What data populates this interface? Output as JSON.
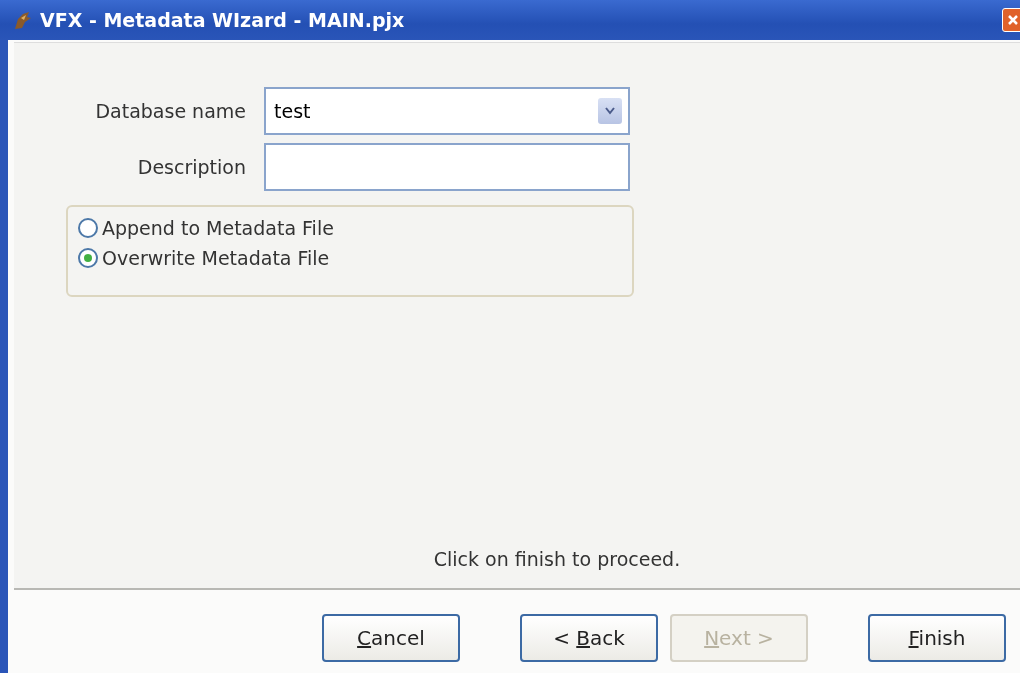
{
  "window": {
    "title": "VFX - Metadata WIzard - MAIN.pjx"
  },
  "fields": [
    {
      "kind": "dropdown",
      "label": "Database name",
      "value": "test"
    },
    {
      "kind": "text",
      "label": "Description"
    }
  ],
  "options": [
    {
      "label": "Append to Metadata File",
      "selected": false
    },
    {
      "label": "Overwrite Metadata File",
      "selected": true
    }
  ],
  "message": "Click on finish to proceed.",
  "buttons": [
    {
      "key": "C",
      "rest": "ancel",
      "disabled": false
    },
    {
      "prefix": "< ",
      "key": "B",
      "rest": "ack",
      "disabled": false
    },
    {
      "key": "N",
      "rest": "ext",
      "suffix": " >",
      "disabled": true
    },
    {
      "key": "F",
      "rest": "inish",
      "disabled": false
    }
  ]
}
